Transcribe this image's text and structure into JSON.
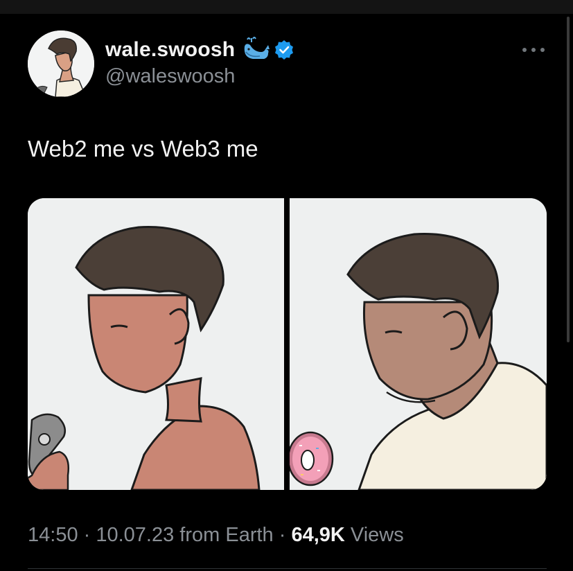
{
  "author": {
    "display_name": "wale.swoosh",
    "handle": "@waleswoosh",
    "name_emoji_icon": "spouting-whale-icon",
    "verified_badge_icon": "verified-checkmark-icon",
    "avatar_icon": "profile-avatar-illustration"
  },
  "tweet": {
    "text": "Web2 me vs Web3 me",
    "more_icon": "more-options-icon"
  },
  "media": {
    "images": [
      {
        "description_icon": "fit-shirtless-man-with-fidget-spinner-illustration"
      },
      {
        "description_icon": "chubby-man-in-tshirt-with-donut-illustration"
      }
    ]
  },
  "meta": {
    "time": "14:50",
    "separator_1": " · ",
    "date": "10.07.23",
    "location": " from Earth",
    "separator_2": " · ",
    "views_count": "64,9K",
    "views_label": " Views"
  },
  "colors": {
    "background": "#000000",
    "text_primary": "#f2f2f2",
    "text_secondary": "#8b9096",
    "verified_blue": "#1d9bf0",
    "panel_background": "#f3f4f4"
  }
}
